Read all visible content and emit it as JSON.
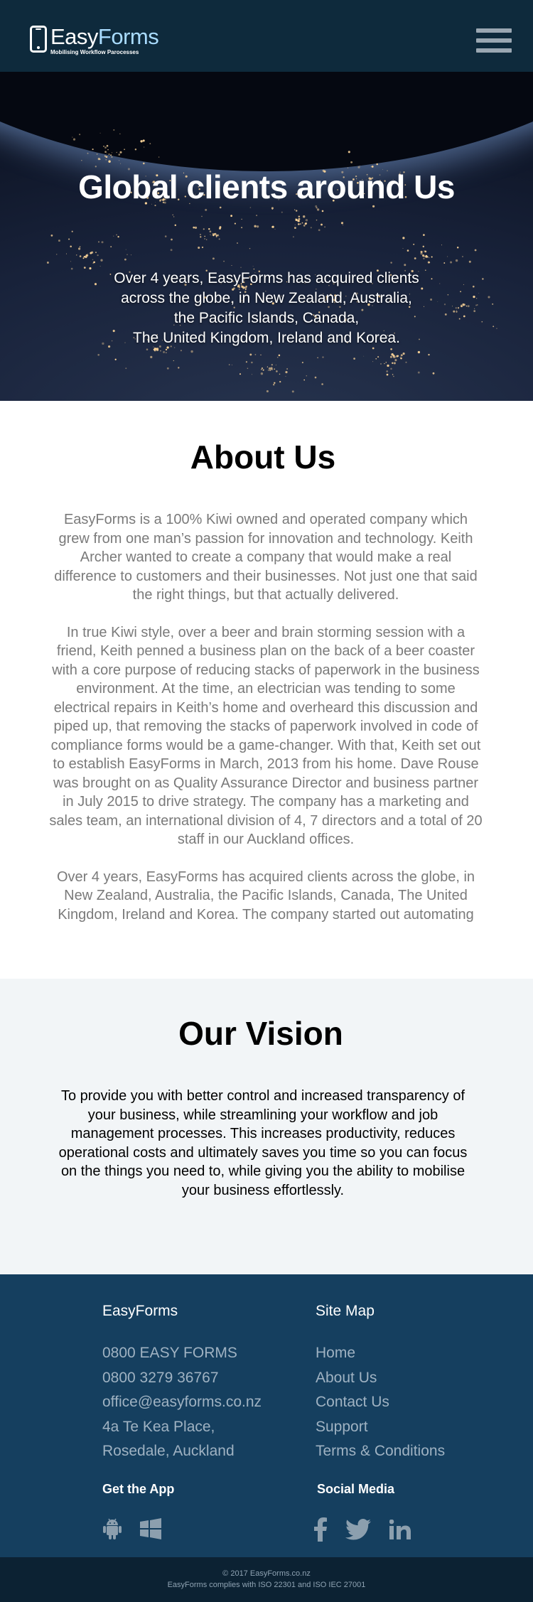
{
  "header": {
    "logo_name_part1": "Easy",
    "logo_name_part2": "Forms",
    "logo_tagline": "Mobilising Workflow Parocesses",
    "menu_icon": "hamburger-menu-icon"
  },
  "hero": {
    "title": "Global clients around Us",
    "lines": [
      "Over 4 years, EasyForms has acquired clients",
      "across the globe, in New Zealand, Australia,",
      "the Pacific Islands, Canada,",
      "The United Kingdom, Ireland and Korea."
    ]
  },
  "about": {
    "title": "About Us",
    "paragraphs": [
      "EasyForms is a 100% Kiwi owned and operated company which grew from one man’s passion for innovation and technology. Keith Archer wanted to create a company that would make a real difference to customers and their businesses. Not just one that said the right things, but that actually delivered.",
      "In true Kiwi style, over a beer and brain storming session with a friend, Keith penned a business plan on the back of a beer coaster with a core purpose of reducing stacks of paperwork in the business environment. At the time, an electrician was tending to some electrical repairs in Keith’s home and overheard this discussion and piped up, that removing the stacks of paperwork involved in code of compliance forms would be a game-changer. With that, Keith set out to establish EasyForms in March, 2013 from his home. Dave Rouse was brought on as Quality Assurance Director and business partner in July 2015 to drive strategy. The company has a marketing and sales team, an international division of 4, 7 directors and a total of 20 staff in our Auckland offices.",
      "Over 4 years, EasyForms has acquired clients across the globe, in New Zealand, Australia, the Pacific Islands, Canada, The United Kingdom, Ireland and Korea. The company started out automating"
    ]
  },
  "vision": {
    "title": "Our Vision",
    "text": "To provide you with better control and increased transparency of your business, while streamlining your workflow and job management processes. This increases productivity, reduces operational costs and ultimately saves you time so you can focus on the things you need to, while giving you the ability to mobilise your business effortlessly."
  },
  "footer": {
    "company": {
      "heading": "EasyForms",
      "phone1": "0800 EASY FORMS",
      "phone2": "0800 3279 36767",
      "email": "office@easyforms.co.nz",
      "address1": "4a Te Kea Place,",
      "address2": "Rosedale, Auckland"
    },
    "sitemap": {
      "heading": "Site Map",
      "links": [
        "Home",
        "About Us",
        "Contact Us",
        "Support",
        "Terms & Conditions"
      ]
    },
    "app_heading": "Get the App",
    "app_icons": [
      "android-icon",
      "windows-icon"
    ],
    "social_heading": "Social Media",
    "social_icons": [
      "facebook-icon",
      "twitter-icon",
      "linkedin-icon"
    ]
  },
  "bottom": {
    "copyright": "© 2017 EasyForms.co.nz",
    "compliance": "EasyForms complies with ISO 22301 and ISO IEC 27001"
  },
  "colors": {
    "header_bg": "#0e2a3c",
    "logo_accent": "#a9dcff",
    "footer_bg": "#153f5f",
    "footer_text": "#9fb2c2",
    "bottom_bar_bg": "#0c2233",
    "vision_bg": "#f2f5f7",
    "body_text_grey": "#7a7a7a"
  }
}
